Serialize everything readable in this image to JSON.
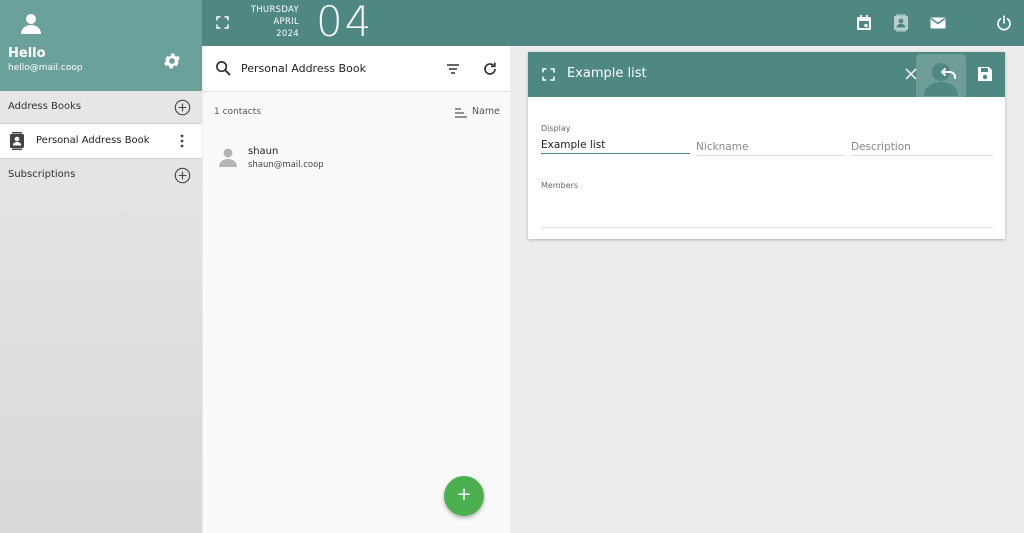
{
  "user": {
    "greeting": "Hello",
    "email": "hello@mail.coop"
  },
  "sidebar": {
    "address_books_label": "Address Books",
    "address_books": [
      {
        "label": "Personal Address Book",
        "active": true
      }
    ],
    "subscriptions_label": "Subscriptions"
  },
  "topbar": {
    "weekday": "THURSDAY",
    "month": "APRIL",
    "year": "2024",
    "day": "04",
    "icons": [
      "calendar-icon",
      "contacts-icon",
      "mail-icon",
      "power-icon"
    ]
  },
  "contacts_panel": {
    "title": "Personal Address Book",
    "count": "1 contacts",
    "sort_label": "Name",
    "contacts": [
      {
        "name": "shaun",
        "email": "shaun@mail.coop"
      }
    ],
    "add_button": "+"
  },
  "editor": {
    "title": "Example list",
    "display_label": "Display",
    "display_value": "Example list",
    "nickname_placeholder": "Nickname",
    "description_placeholder": "Description",
    "members_label": "Members"
  },
  "colors": {
    "header_teal": "#4f8782",
    "user_panel_teal": "#6aa19b",
    "fab_green": "#4caf50"
  }
}
